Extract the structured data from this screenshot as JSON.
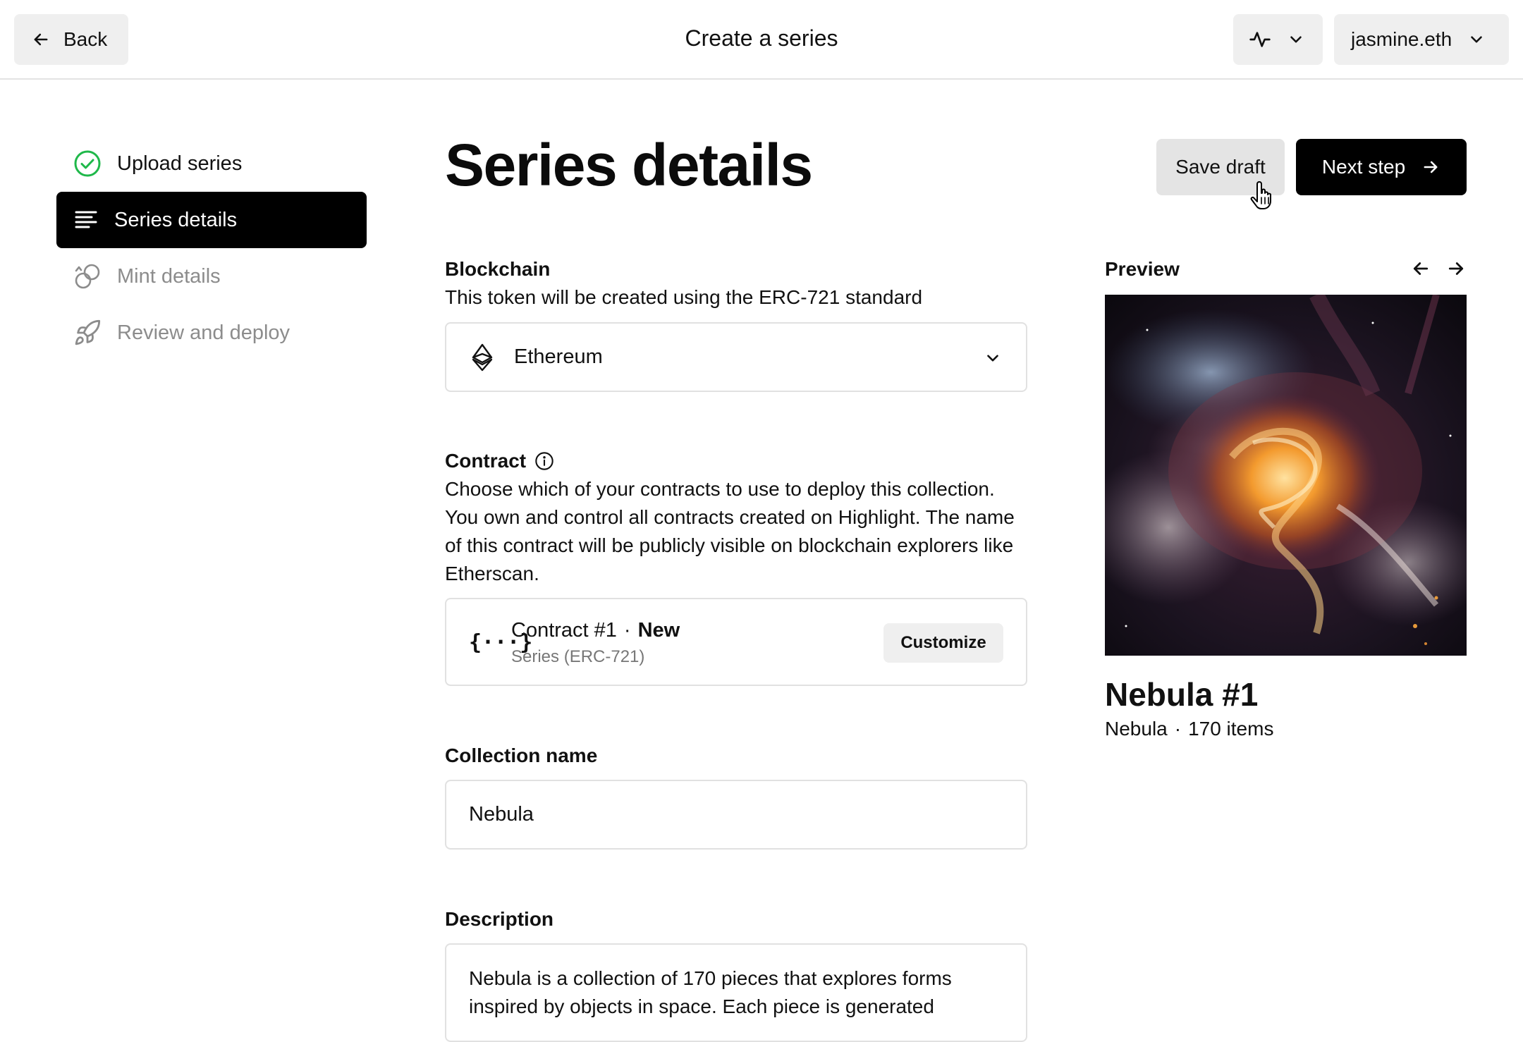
{
  "topbar": {
    "back_label": "Back",
    "title": "Create a series",
    "account_label": "jasmine.eth",
    "activity_icon": "activity-icon"
  },
  "sidebar": {
    "items": [
      {
        "label": "Upload series",
        "icon": "check-circle-icon",
        "state": "complete"
      },
      {
        "label": "Series details",
        "icon": "lines-icon",
        "state": "active"
      },
      {
        "label": "Mint details",
        "icon": "coins-icon",
        "state": "upcoming"
      },
      {
        "label": "Review and deploy",
        "icon": "rocket-icon",
        "state": "upcoming"
      }
    ]
  },
  "main": {
    "title": "Series details",
    "save_label": "Save draft",
    "next_label": "Next step",
    "blockchain": {
      "label": "Blockchain",
      "description": "This token will be created using the ERC-721 standard",
      "selected": "Ethereum"
    },
    "contract": {
      "label": "Contract",
      "description": "Choose which of your contracts to use to deploy this collection. You own and control all contracts created on Highlight. The name of this contract will be publicly visible on blockchain explorers like Etherscan.",
      "name": "Contract #1",
      "separator": "·",
      "status": "New",
      "type": "Series (ERC-721)",
      "customize_label": "Customize"
    },
    "collection_name": {
      "label": "Collection name",
      "value": "Nebula"
    },
    "description": {
      "label": "Description",
      "value": "Nebula is a collection of 170 pieces that explores forms inspired by objects in space. Each piece is generated"
    }
  },
  "preview": {
    "label": "Preview",
    "name": "Nebula #1",
    "collection": "Nebula",
    "separator": "·",
    "count": "170 items"
  },
  "colors": {
    "accent_black": "#000000",
    "success_green": "#1fb84a",
    "muted_gray": "#8c8c8c"
  }
}
